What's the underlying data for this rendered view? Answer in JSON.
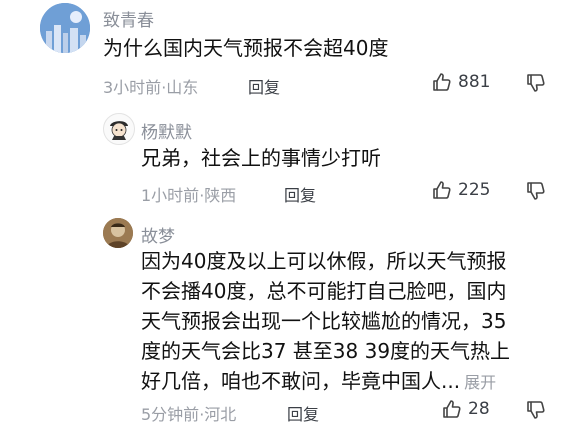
{
  "comments": [
    {
      "user": "致青春",
      "text": "为什么国内天气预报不会超40度",
      "time": "3小时前",
      "location": "山东",
      "reply_label": "回复",
      "likes": "881",
      "avatar_icon": "city-skyline-avatar"
    },
    {
      "user": "杨默默",
      "text": "兄弟，社会上的事情少打听",
      "time": "1小时前",
      "location": "陕西",
      "reply_label": "回复",
      "likes": "225",
      "avatar_icon": "cartoon-avatar"
    },
    {
      "user": "故梦",
      "text_lines": [
        "因为40度及以上可以休假，所以天气预报",
        "不会播40度，总不可能打自己脸吧，国内",
        "天气预报会出现一个比较尴尬的情况，35",
        "度的天气会比37 甚至38  39度的天气热上",
        "好几倍，咱也不敢问，毕竟中国人..."
      ],
      "expand_label": "展开",
      "time": "5分钟前",
      "location": "河北",
      "reply_label": "回复",
      "likes": "28",
      "avatar_icon": "photo-avatar"
    }
  ],
  "meta_separator": "·"
}
